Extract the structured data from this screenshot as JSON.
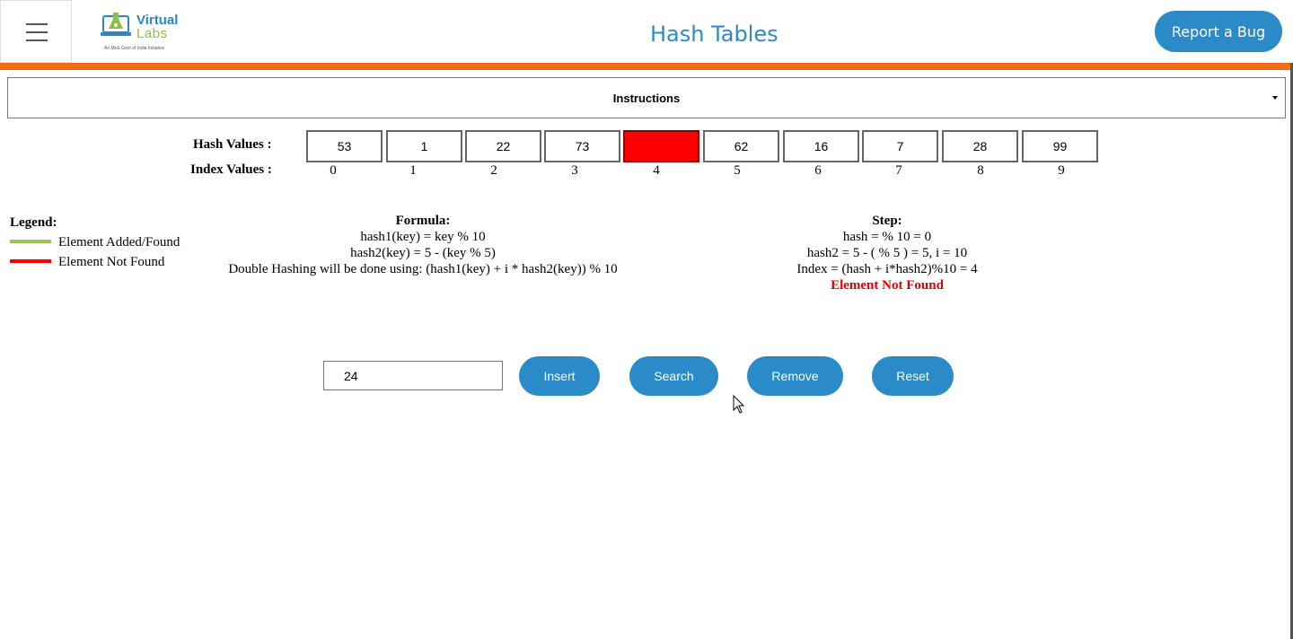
{
  "header": {
    "logo_line1": "Virtual",
    "logo_line2": "Labs",
    "logo_tagline": "An MoE Govt of India Initiative",
    "title": "Hash Tables",
    "report_bug_label": "Report a Bug"
  },
  "instructions": {
    "label": "Instructions"
  },
  "table": {
    "hash_label": "Hash Values :",
    "index_label": "Index Values :",
    "cells": [
      {
        "value": "53",
        "index": "0",
        "state": "normal"
      },
      {
        "value": "1",
        "index": "1",
        "state": "normal"
      },
      {
        "value": "22",
        "index": "2",
        "state": "normal"
      },
      {
        "value": "73",
        "index": "3",
        "state": "normal"
      },
      {
        "value": "",
        "index": "4",
        "state": "not-found"
      },
      {
        "value": "62",
        "index": "5",
        "state": "normal"
      },
      {
        "value": "16",
        "index": "6",
        "state": "normal"
      },
      {
        "value": "7",
        "index": "7",
        "state": "normal"
      },
      {
        "value": "28",
        "index": "8",
        "state": "normal"
      },
      {
        "value": "99",
        "index": "9",
        "state": "normal"
      }
    ]
  },
  "legend": {
    "title": "Legend:",
    "added_label": "Element Added/Found",
    "added_color": "#9bc54b",
    "not_found_label": "Element Not Found",
    "not_found_color": "#ff0000"
  },
  "formula": {
    "title": "Formula:",
    "line1": "hash1(key) = key % 10",
    "line2": "hash2(key) = 5 - (key % 5)",
    "line3": "Double Hashing will be done using: (hash1(key) + i * hash2(key)) % 10"
  },
  "step": {
    "title": "Step:",
    "line1": "hash = % 10 = 0",
    "line2": "hash2 = 5 - ( % 5 ) = 5, i = 10",
    "line3": "Index = (hash + i*hash2)%10 = 4",
    "result": "Element Not Found"
  },
  "controls": {
    "key_value": "24",
    "insert_label": "Insert",
    "search_label": "Search",
    "remove_label": "Remove",
    "reset_label": "Reset"
  }
}
